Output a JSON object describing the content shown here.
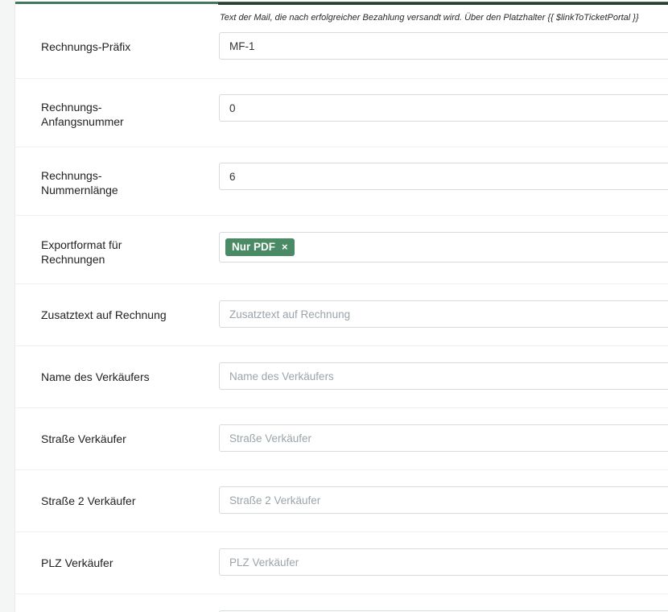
{
  "help": {
    "mail_text": "Text der Mail, die nach erfolgreicher Bezahlung versandt wird. Über den Platzhalter {{ $linkToTicketPortal }}"
  },
  "fields": {
    "invoice_prefix": {
      "label": "Rechnungs-Präfix",
      "value": "MF-1"
    },
    "invoice_start_number": {
      "label_line1": "Rechnungs-",
      "label_line2": "Anfangsnummer",
      "value": "0"
    },
    "invoice_number_length": {
      "label_line1": "Rechnungs-",
      "label_line2": "Nummernlänge",
      "value": "6"
    },
    "export_format": {
      "label_line1": "Exportformat für",
      "label_line2": "Rechnungen",
      "tag": "Nur PDF",
      "tag_remove": "×"
    },
    "additional_text": {
      "label": "Zusatztext auf Rechnung",
      "placeholder": "Zusatztext auf Rechnung"
    },
    "seller_name": {
      "label": "Name des Verkäufers",
      "placeholder": "Name des Verkäufers"
    },
    "seller_street": {
      "label": "Straße Verkäufer",
      "placeholder": "Straße Verkäufer"
    },
    "seller_street2": {
      "label": "Straße 2 Verkäufer",
      "placeholder": "Straße 2 Verkäufer"
    },
    "seller_zip": {
      "label": "PLZ Verkäufer",
      "placeholder": "PLZ Verkäufer"
    }
  },
  "colors": {
    "accent": "#4a8a65",
    "header_bar": "#44775a"
  }
}
